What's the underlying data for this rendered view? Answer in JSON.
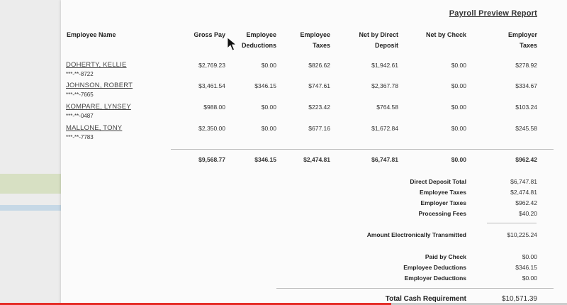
{
  "report_title": "Payroll Preview Report",
  "columns": {
    "name": "Employee Name",
    "gross": "Gross Pay",
    "deductions": [
      "Employee",
      "Deductions"
    ],
    "emp_taxes": [
      "Employee",
      "Taxes"
    ],
    "net_direct": [
      "Net by Direct",
      "Deposit"
    ],
    "net_check": "Net by Check",
    "employer_taxes": [
      "Employer",
      "Taxes"
    ]
  },
  "employees": [
    {
      "name": "DOHERTY, KELLIE",
      "ssn": "***-**-8722",
      "gross": "$2,769.23",
      "deductions": "$0.00",
      "emp_taxes": "$826.62",
      "net_direct": "$1,942.61",
      "net_check": "$0.00",
      "employer_taxes": "$278.92"
    },
    {
      "name": "JOHNSON, ROBERT",
      "ssn": "***-**-7665",
      "gross": "$3,461.54",
      "deductions": "$346.15",
      "emp_taxes": "$747.61",
      "net_direct": "$2,367.78",
      "net_check": "$0.00",
      "employer_taxes": "$334.67"
    },
    {
      "name": "KOMPARE, LYNSEY",
      "ssn": "***-**-0487",
      "gross": "$988.00",
      "deductions": "$0.00",
      "emp_taxes": "$223.42",
      "net_direct": "$764.58",
      "net_check": "$0.00",
      "employer_taxes": "$103.24"
    },
    {
      "name": "MALLONE, TONY",
      "ssn": "***-**-7783",
      "gross": "$2,350.00",
      "deductions": "$0.00",
      "emp_taxes": "$677.16",
      "net_direct": "$1,672.84",
      "net_check": "$0.00",
      "employer_taxes": "$245.58"
    }
  ],
  "totals": {
    "gross": "$9,568.77",
    "deductions": "$346.15",
    "emp_taxes": "$2,474.81",
    "net_direct": "$6,747.81",
    "net_check": "$0.00",
    "employer_taxes": "$962.42"
  },
  "summary": {
    "direct_deposit_total": {
      "label": "Direct Deposit Total",
      "value": "$6,747.81"
    },
    "employee_taxes": {
      "label": "Employee Taxes",
      "value": "$2,474.81"
    },
    "employer_taxes": {
      "label": "Employer Taxes",
      "value": "$962.42"
    },
    "processing_fees": {
      "label": "Processing Fees",
      "value": "$40.20"
    },
    "amount_transmitted": {
      "label": "Amount Electronically Transmitted",
      "value": "$10,225.24"
    },
    "paid_by_check": {
      "label": "Paid by Check",
      "value": "$0.00"
    },
    "employee_deductions": {
      "label": "Employee Deductions",
      "value": "$346.15"
    },
    "employer_deductions": {
      "label": "Employer Deductions",
      "value": "$0.00"
    },
    "total_cash": {
      "label": "Total Cash Requirement",
      "value": "$10,571.39"
    }
  },
  "icons": {
    "cursor": "mouse-pointer-icon"
  },
  "colors": {
    "video_progress": "#e52d27",
    "green_band": "#d7e0c3",
    "blue_band": "#c6d8e6"
  },
  "video_progress_fraction": 0.69
}
